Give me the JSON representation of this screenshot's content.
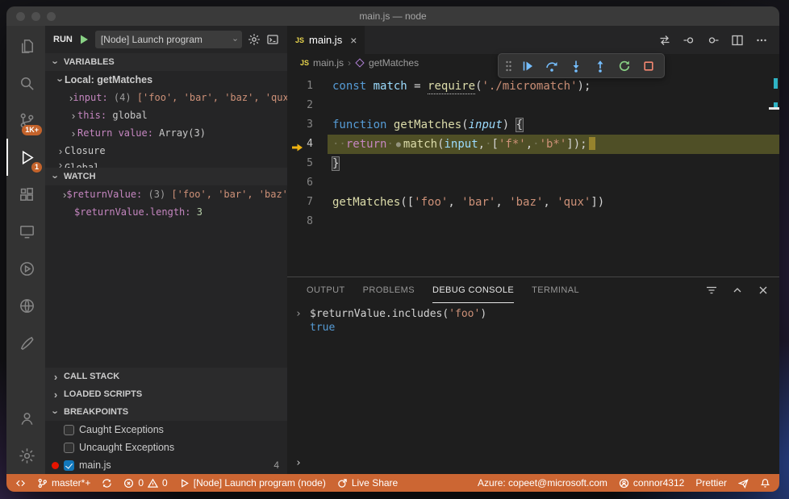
{
  "window": {
    "title": "main.js — node"
  },
  "activity": {
    "scm_badge": "1K+",
    "debug_badge": "1"
  },
  "run_bar": {
    "run_label": "RUN",
    "config_label": "[Node] Launch program"
  },
  "sidebar": {
    "variables": {
      "header": "VARIABLES",
      "scope": "Local: getMatches",
      "rows": [
        {
          "tokens": [
            {
              "t": "input: ",
              "c": "vname"
            },
            {
              "t": "(4) ",
              "c": "dim"
            },
            {
              "t": "['foo', 'bar', 'baz', 'qux']",
              "c": "vstr"
            }
          ]
        },
        {
          "tokens": [
            {
              "t": "this: ",
              "c": "vname"
            },
            {
              "t": "global",
              "c": "vplain"
            }
          ]
        },
        {
          "tokens": [
            {
              "t": "Return value: ",
              "c": "vname"
            },
            {
              "t": "Array(3)",
              "c": "vplain"
            }
          ]
        },
        {
          "tokens": [
            {
              "t": "Closure",
              "c": "vscope"
            }
          ]
        },
        {
          "tokens": [
            {
              "t": "Global",
              "c": "vscope"
            }
          ]
        }
      ]
    },
    "watch": {
      "header": "WATCH",
      "rows": [
        {
          "tokens": [
            {
              "t": "$returnValue: ",
              "c": "vname"
            },
            {
              "t": "(3) ",
              "c": "dim"
            },
            {
              "t": "['foo', 'bar', 'baz']",
              "c": "vstr"
            }
          ]
        },
        {
          "tokens": [
            {
              "t": "$returnValue.length: ",
              "c": "vname"
            },
            {
              "t": "3",
              "c": "vnum"
            }
          ]
        }
      ]
    },
    "call_stack_header": "CALL STACK",
    "loaded_scripts_header": "LOADED SCRIPTS",
    "breakpoints": {
      "header": "BREAKPOINTS",
      "rows": [
        {
          "label": "Caught Exceptions",
          "checked": false
        },
        {
          "label": "Uncaught Exceptions",
          "checked": false
        },
        {
          "label": "main.js",
          "checked": true,
          "line": "4"
        }
      ]
    }
  },
  "editor": {
    "tab": {
      "label": "main.js",
      "icon_label": "JS"
    },
    "breadcrumbs": {
      "file": "main.js",
      "file_icon_label": "JS",
      "symbol": "getMatches"
    },
    "lines": [
      {
        "num": "1",
        "tokens": [
          {
            "t": "const",
            "c": "kw"
          },
          {
            "t": " ",
            "c": "pl"
          },
          {
            "t": "match",
            "c": "var"
          },
          {
            "t": " = ",
            "c": "pl"
          },
          {
            "t": "require",
            "c": "fn udots"
          },
          {
            "t": "(",
            "c": "pl"
          },
          {
            "t": "'./micromatch'",
            "c": "str"
          },
          {
            "t": ");",
            "c": "pl"
          }
        ]
      },
      {
        "num": "2",
        "tokens": []
      },
      {
        "num": "3",
        "tokens": [
          {
            "t": "function",
            "c": "kw"
          },
          {
            "t": " ",
            "c": "pl"
          },
          {
            "t": "getMatches",
            "c": "fn"
          },
          {
            "t": "(",
            "c": "pl"
          },
          {
            "t": "input",
            "c": "param"
          },
          {
            "t": ") ",
            "c": "pl"
          },
          {
            "t": "{",
            "c": "pl bm"
          }
        ]
      },
      {
        "num": "4",
        "current": true,
        "tokens": [
          {
            "t": "··",
            "c": "ws"
          },
          {
            "t": "return",
            "c": "ctrl"
          },
          {
            "t": "·",
            "c": "ws"
          },
          {
            "t": "●",
            "c": "inlinebp"
          },
          {
            "t": "match",
            "c": "fn"
          },
          {
            "t": "(",
            "c": "pl"
          },
          {
            "t": "input",
            "c": "var"
          },
          {
            "t": ",",
            "c": "pl"
          },
          {
            "t": "·",
            "c": "ws"
          },
          {
            "t": "[",
            "c": "pl"
          },
          {
            "t": "'f*'",
            "c": "str"
          },
          {
            "t": ",",
            "c": "pl"
          },
          {
            "t": "·",
            "c": "ws"
          },
          {
            "t": "'b*'",
            "c": "str"
          },
          {
            "t": "]);",
            "c": "pl"
          },
          {
            "t": " ",
            "c": "colhl"
          }
        ]
      },
      {
        "num": "5",
        "tokens": [
          {
            "t": "}",
            "c": "pl bm"
          }
        ]
      },
      {
        "num": "6",
        "tokens": []
      },
      {
        "num": "7",
        "tokens": [
          {
            "t": "getMatches",
            "c": "fn"
          },
          {
            "t": "([",
            "c": "pl"
          },
          {
            "t": "'foo'",
            "c": "str"
          },
          {
            "t": ", ",
            "c": "pl"
          },
          {
            "t": "'bar'",
            "c": "str"
          },
          {
            "t": ", ",
            "c": "pl"
          },
          {
            "t": "'baz'",
            "c": "str"
          },
          {
            "t": ", ",
            "c": "pl"
          },
          {
            "t": "'qux'",
            "c": "str"
          },
          {
            "t": "])",
            "c": "pl"
          }
        ]
      },
      {
        "num": "8",
        "tokens": []
      }
    ]
  },
  "panel": {
    "tabs": [
      {
        "label": "OUTPUT"
      },
      {
        "label": "PROBLEMS"
      },
      {
        "label": "DEBUG CONSOLE",
        "active": true
      },
      {
        "label": "TERMINAL"
      }
    ],
    "console": {
      "expression_tokens": [
        {
          "t": "$returnValue.includes(",
          "c": "pl"
        },
        {
          "t": "'foo'",
          "c": "str"
        },
        {
          "t": ")",
          "c": "pl"
        }
      ],
      "result": "true"
    }
  },
  "status": {
    "branch": "master*+",
    "errors": "0",
    "warnings": "0",
    "launch": "[Node] Launch program (node)",
    "live_share": "Live Share",
    "azure": "Azure: copeet@microsoft.com",
    "account": "connor4312",
    "formatter": "Prettier"
  }
}
